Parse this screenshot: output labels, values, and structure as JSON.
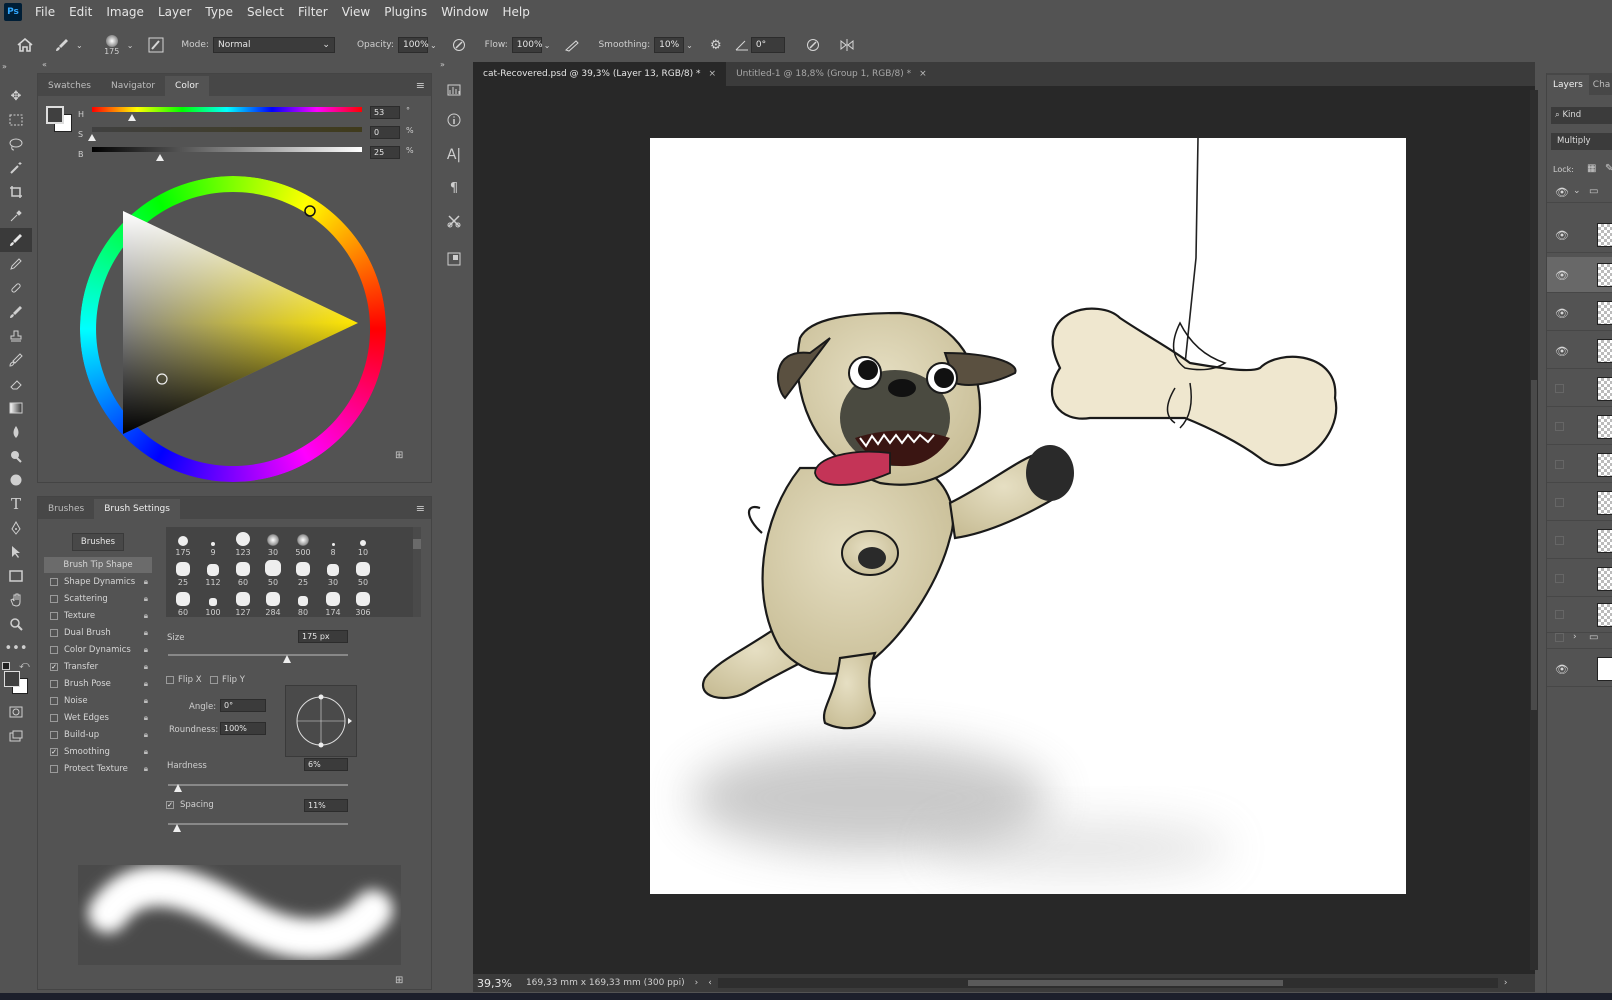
{
  "app": {
    "logo": "Ps"
  },
  "menu": [
    "File",
    "Edit",
    "Image",
    "Layer",
    "Type",
    "Select",
    "Filter",
    "View",
    "Plugins",
    "Window",
    "Help"
  ],
  "options": {
    "brush_size": "175",
    "mode_label": "Mode:",
    "mode_value": "Normal",
    "opacity_label": "Opacity:",
    "opacity_value": "100%",
    "flow_label": "Flow:",
    "flow_value": "100%",
    "smoothing_label": "Smoothing:",
    "smoothing_value": "10%",
    "angle_value": "0°"
  },
  "color_panel": {
    "tabs": [
      "Swatches",
      "Navigator",
      "Color"
    ],
    "h_label": "H",
    "h_value": "53",
    "h_unit": "°",
    "s_label": "S",
    "s_value": "0",
    "s_unit": "%",
    "b_label": "B",
    "b_value": "25",
    "b_unit": "%",
    "hue_fraction": 0.147,
    "sat_fraction": 0.0,
    "bright_fraction": 0.25
  },
  "brush_panel": {
    "tabs": [
      "Brushes",
      "Brush Settings"
    ],
    "brushes_button": "Brushes",
    "settings": [
      {
        "label": "Brush Tip Shape",
        "checked": null,
        "lock": false
      },
      {
        "label": "Shape Dynamics",
        "checked": false,
        "lock": true
      },
      {
        "label": "Scattering",
        "checked": false,
        "lock": true
      },
      {
        "label": "Texture",
        "checked": false,
        "lock": true
      },
      {
        "label": "Dual Brush",
        "checked": false,
        "lock": true
      },
      {
        "label": "Color Dynamics",
        "checked": false,
        "lock": true
      },
      {
        "label": "Transfer",
        "checked": true,
        "lock": true
      },
      {
        "label": "Brush Pose",
        "checked": false,
        "lock": true
      },
      {
        "label": "Noise",
        "checked": false,
        "lock": true
      },
      {
        "label": "Wet Edges",
        "checked": false,
        "lock": true
      },
      {
        "label": "Build-up",
        "checked": false,
        "lock": true
      },
      {
        "label": "Smoothing",
        "checked": true,
        "lock": true
      },
      {
        "label": "Protect Texture",
        "checked": false,
        "lock": true
      }
    ],
    "tips_row1": [
      "175",
      "9",
      "123",
      "30",
      "500",
      "8",
      "10"
    ],
    "tips_row2": [
      "25",
      "112",
      "60",
      "50",
      "25",
      "30",
      "50"
    ],
    "tips_row3": [
      "60",
      "100",
      "127",
      "284",
      "80",
      "174",
      "306"
    ],
    "size_label": "Size",
    "size_value": "175 px",
    "flipx_label": "Flip X",
    "flipy_label": "Flip Y",
    "angle_label": "Angle:",
    "angle_value": "0°",
    "roundness_label": "Roundness:",
    "roundness_value": "100%",
    "hardness_label": "Hardness",
    "hardness_value": "6%",
    "spacing_label": "Spacing",
    "spacing_value": "11%"
  },
  "documents": [
    {
      "title": "cat-Recovered.psd @ 39,3% (Layer 13, RGB/8) *",
      "active": true
    },
    {
      "title": "Untitled-1 @ 18,8% (Group 1, RGB/8) *",
      "active": false
    }
  ],
  "status": {
    "zoom": "39,3%",
    "doc_size": "169,33 mm x 169,33 mm (300 ppi)"
  },
  "layers_panel": {
    "tabs": [
      "Layers",
      "Cha"
    ],
    "kind_label": "Kind",
    "blend_mode": "Multiply",
    "lock_label": "Lock:"
  }
}
